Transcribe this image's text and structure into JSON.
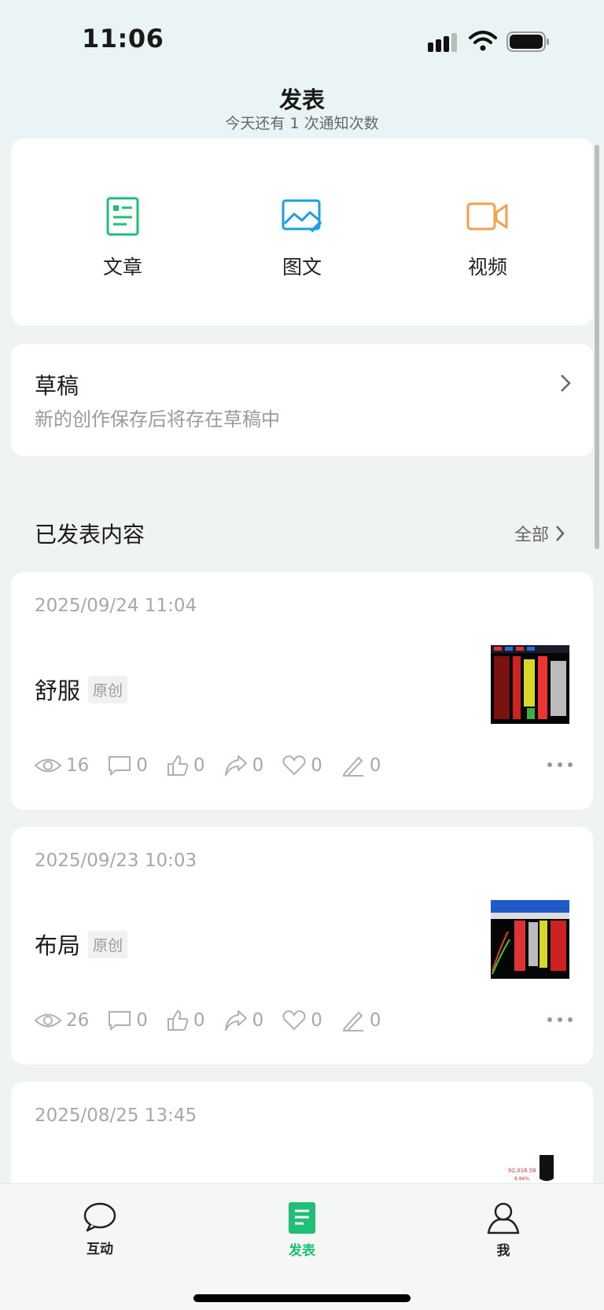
{
  "status": {
    "time": "11:06"
  },
  "header": {
    "title": "发表",
    "subtitle": "今天还有 1 次通知次数"
  },
  "publish": {
    "items": [
      {
        "label": "文章",
        "icon": "article-icon",
        "color": "#1fbf75"
      },
      {
        "label": "图文",
        "icon": "image-text-icon",
        "color": "#1a9fe0"
      },
      {
        "label": "视频",
        "icon": "video-icon",
        "color": "#f2a04a"
      }
    ]
  },
  "drafts": {
    "title": "草稿",
    "subtitle": "新的创作保存后将存在草稿中"
  },
  "published": {
    "title": "已发表内容",
    "all_label": "全部"
  },
  "posts": [
    {
      "date": "2025/09/24 11:04",
      "title": "舒服",
      "tag": "原创",
      "views": "16",
      "comments": "0",
      "likes": "0",
      "shares": "0",
      "favorites": "0",
      "notes": "0"
    },
    {
      "date": "2025/09/23 10:03",
      "title": "布局",
      "tag": "原创",
      "views": "26",
      "comments": "0",
      "likes": "0",
      "shares": "0",
      "favorites": "0",
      "notes": "0"
    },
    {
      "date": "2025/08/25 13:45"
    }
  ],
  "thumb3": {
    "line1": "92,016.58",
    "line2": "8.94%"
  },
  "tabs": [
    {
      "label": "互动"
    },
    {
      "label": "发表"
    },
    {
      "label": "我"
    }
  ],
  "colors": {
    "accent": "#1fbf75",
    "secondary_text": "#a8a8a8"
  }
}
